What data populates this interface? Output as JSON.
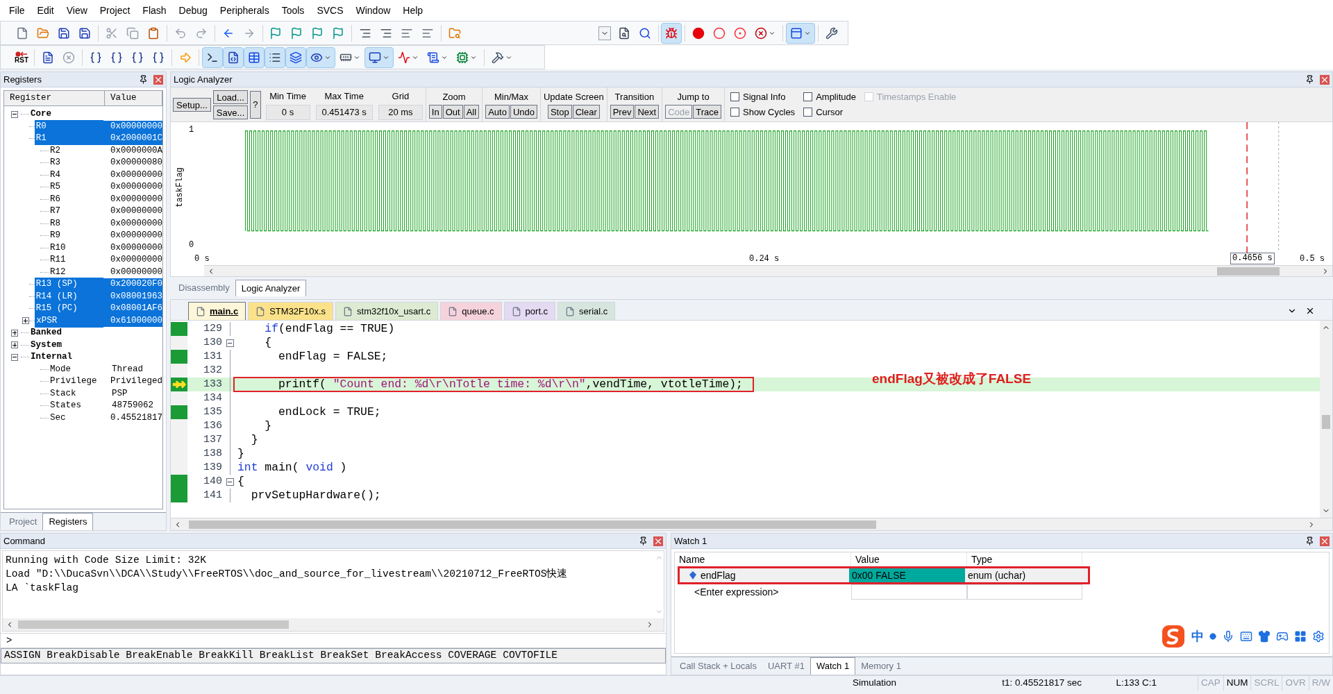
{
  "menu": [
    "File",
    "Edit",
    "View",
    "Project",
    "Flash",
    "Debug",
    "Peripherals",
    "Tools",
    "SVCS",
    "Window",
    "Help"
  ],
  "toolbar_file": [
    {
      "kind": "new",
      "on": false
    },
    {
      "kind": "open",
      "on": false
    },
    {
      "kind": "save",
      "on": false
    },
    {
      "kind": "save",
      "on": false
    },
    {
      "kind": "sep"
    },
    {
      "kind": "cut",
      "on": false
    },
    {
      "kind": "copy",
      "on": false
    },
    {
      "kind": "paste",
      "on": false
    },
    {
      "kind": "sep"
    },
    {
      "kind": "undo",
      "on": false
    },
    {
      "kind": "redo",
      "on": false
    },
    {
      "kind": "sep"
    },
    {
      "kind": "back",
      "on": false
    },
    {
      "kind": "forward",
      "on": false
    },
    {
      "kind": "sep"
    },
    {
      "kind": "flag",
      "on": false
    },
    {
      "kind": "flag",
      "on": false
    },
    {
      "kind": "flag",
      "on": false
    },
    {
      "kind": "flag",
      "on": false
    },
    {
      "kind": "sep"
    },
    {
      "kind": "indent",
      "on": false
    },
    {
      "kind": "indent",
      "on": false
    },
    {
      "kind": "lines",
      "on": false
    },
    {
      "kind": "lines",
      "on": false
    },
    {
      "kind": "sep"
    },
    {
      "kind": "folder-search",
      "on": false
    },
    {
      "kind": "gap"
    },
    {
      "kind": "combo",
      "on": false
    },
    {
      "kind": "file-search",
      "on": false
    },
    {
      "kind": "find",
      "on": false
    },
    {
      "kind": "sep"
    },
    {
      "kind": "debug",
      "on": true
    },
    {
      "kind": "sep"
    },
    {
      "kind": "bp",
      "on": false
    },
    {
      "kind": "bp-off",
      "on": false
    },
    {
      "kind": "bp-disable",
      "on": false
    },
    {
      "kind": "bp-kill",
      "on": false
    },
    {
      "kind": "sep"
    },
    {
      "kind": "layout",
      "on": true
    },
    {
      "kind": "sep"
    },
    {
      "kind": "wrench",
      "on": false
    }
  ],
  "toolbar_debug": {
    "reset_label": "RST",
    "items": [
      {
        "kind": "step-file",
        "on": false
      },
      {
        "kind": "stop",
        "on": false
      },
      {
        "kind": "sep"
      },
      {
        "kind": "braces",
        "on": false
      },
      {
        "kind": "braces",
        "on": false
      },
      {
        "kind": "braces",
        "on": false
      },
      {
        "kind": "braces",
        "on": false
      },
      {
        "kind": "sep"
      },
      {
        "kind": "run-cursor",
        "on": false
      },
      {
        "kind": "sep"
      },
      {
        "kind": "terminal",
        "on": true
      },
      {
        "kind": "disasm",
        "on": true
      },
      {
        "kind": "symbols",
        "on": true
      },
      {
        "kind": "registers",
        "on": true
      },
      {
        "kind": "callstack",
        "on": true
      },
      {
        "kind": "watch",
        "on": true
      },
      {
        "kind": "memory",
        "on": false
      },
      {
        "kind": "serial",
        "on": true
      },
      {
        "kind": "analysis",
        "on": false
      },
      {
        "kind": "trace",
        "on": false
      },
      {
        "kind": "chip",
        "on": false
      },
      {
        "kind": "sep"
      },
      {
        "kind": "toolbox",
        "on": false
      }
    ]
  },
  "registers": {
    "title": "Registers",
    "columns": [
      "Register",
      "Value"
    ],
    "tree": [
      {
        "name": "Core",
        "expanded": true,
        "children": [
          {
            "name": "R0",
            "value": "0x00000000",
            "selected": true
          },
          {
            "name": "R1",
            "value": "0x2000001C",
            "selected": true
          },
          {
            "name": "R2",
            "value": "0x0000000A",
            "selected": false
          },
          {
            "name": "R3",
            "value": "0x00000080",
            "selected": false
          },
          {
            "name": "R4",
            "value": "0x00000000",
            "selected": false
          },
          {
            "name": "R5",
            "value": "0x00000000",
            "selected": false
          },
          {
            "name": "R6",
            "value": "0x00000000",
            "selected": false
          },
          {
            "name": "R7",
            "value": "0x00000000",
            "selected": false
          },
          {
            "name": "R8",
            "value": "0x00000000",
            "selected": false
          },
          {
            "name": "R9",
            "value": "0x00000000",
            "selected": false
          },
          {
            "name": "R10",
            "value": "0x00000000",
            "selected": false
          },
          {
            "name": "R11",
            "value": "0x00000000",
            "selected": false
          },
          {
            "name": "R12",
            "value": "0x00000000",
            "selected": false
          },
          {
            "name": "R13 (SP)",
            "value": "0x200020F0",
            "selected": true
          },
          {
            "name": "R14 (LR)",
            "value": "0x08001963",
            "selected": true
          },
          {
            "name": "R15 (PC)",
            "value": "0x08001AF6",
            "selected": true
          },
          {
            "name": "xPSR",
            "value": "0x61000000",
            "selected": true,
            "expanded": false
          }
        ]
      },
      {
        "name": "Banked",
        "expanded": false
      },
      {
        "name": "System",
        "expanded": false
      },
      {
        "name": "Internal",
        "expanded": true,
        "children": [
          {
            "name": "Mode",
            "value": "Thread",
            "selected": false
          },
          {
            "name": "Privilege",
            "value": "Privileged",
            "selected": false
          },
          {
            "name": "Stack",
            "value": "PSP",
            "selected": false
          },
          {
            "name": "States",
            "value": "48759062",
            "selected": false
          },
          {
            "name": "Sec",
            "value": "0.45521817",
            "selected": false
          }
        ]
      }
    ],
    "tabs": [
      {
        "label": "Project",
        "selected": false
      },
      {
        "label": "Registers",
        "selected": true
      }
    ]
  },
  "logic_analyzer": {
    "title": "Logic Analyzer",
    "setup": "Setup...",
    "load": "Load...",
    "save": "Save...",
    "help": "?",
    "fields": [
      {
        "label": "Min Time",
        "value": "0 s"
      },
      {
        "label": "Max Time",
        "value": "0.451473 s"
      },
      {
        "label": "Grid",
        "value": "20 ms"
      }
    ],
    "groups": [
      {
        "label": "Zoom",
        "buttons": [
          {
            "label": "In",
            "disabled": false
          },
          {
            "label": "Out",
            "disabled": false
          },
          {
            "label": "All",
            "disabled": false
          }
        ]
      },
      {
        "label": "Min/Max",
        "buttons": [
          {
            "label": "Auto",
            "disabled": false
          },
          {
            "label": "Undo",
            "disabled": false
          }
        ]
      },
      {
        "label": "Update Screen",
        "buttons": [
          {
            "label": "Stop",
            "disabled": false
          },
          {
            "label": "Clear",
            "disabled": false
          }
        ]
      },
      {
        "label": "Transition",
        "buttons": [
          {
            "label": "Prev",
            "disabled": false
          },
          {
            "label": "Next",
            "disabled": false
          }
        ]
      },
      {
        "label": "Jump to",
        "buttons": [
          {
            "label": "Code",
            "disabled": true
          },
          {
            "label": "Trace",
            "disabled": false
          }
        ]
      }
    ],
    "options": [
      {
        "label": "Signal Info",
        "checked": false,
        "disabled": false
      },
      {
        "label": "Amplitude",
        "checked": false,
        "disabled": false
      },
      {
        "label": "Timestamps Enable",
        "checked": false,
        "disabled": true
      },
      {
        "label": "Show Cycles",
        "checked": false,
        "disabled": false
      },
      {
        "label": "Cursor",
        "checked": false,
        "disabled": false
      }
    ],
    "signal": "taskFlag",
    "y_high": "1",
    "y_low": "0",
    "x_labels": [
      "0 s",
      "0.24 s",
      "0.5 s"
    ],
    "cursor_time": "0.4656 s"
  },
  "view_tabs": [
    {
      "label": "Disassembly",
      "selected": false
    },
    {
      "label": "Logic Analyzer",
      "selected": true
    }
  ],
  "file_tabs": [
    {
      "label": "main.c",
      "selected": true,
      "color": "#fdf6d8"
    },
    {
      "label": "STM32F10x.s",
      "selected": false,
      "color": "#fbe28a"
    },
    {
      "label": "stm32f10x_usart.c",
      "selected": false,
      "color": "#dcebd2"
    },
    {
      "label": "queue.c",
      "selected": false,
      "color": "#f6d3dc"
    },
    {
      "label": "port.c",
      "selected": false,
      "color": "#e4daf2"
    },
    {
      "label": "serial.c",
      "selected": false,
      "color": "#d6e6de"
    }
  ],
  "code": [
    {
      "number": "129",
      "executable": true,
      "current": false,
      "fold": false,
      "segments": [
        {
          "kind": "keyword",
          "text": "    if"
        },
        {
          "kind": "plain",
          "text": "(endFlag == TRUE)"
        }
      ]
    },
    {
      "number": "130",
      "executable": false,
      "current": false,
      "fold": true,
      "segments": [
        {
          "kind": "plain",
          "text": "    {"
        }
      ]
    },
    {
      "number": "131",
      "executable": true,
      "current": false,
      "fold": false,
      "segments": [
        {
          "kind": "plain",
          "text": "      endFlag = FALSE;"
        }
      ]
    },
    {
      "number": "132",
      "executable": false,
      "current": false,
      "fold": false
    },
    {
      "number": "133",
      "executable": true,
      "current": true,
      "fold": false,
      "boxed": true,
      "segments": [
        {
          "kind": "plain",
          "text": "      printf( "
        },
        {
          "kind": "string",
          "text": "\"Count end: %d\\r\\nTotle time: %d\\r\\n\""
        },
        {
          "kind": "plain",
          "text": ",vendTime, vtotleTime);"
        }
      ]
    },
    {
      "number": "134",
      "executable": false,
      "current": false,
      "fold": false
    },
    {
      "number": "135",
      "executable": true,
      "current": false,
      "fold": false,
      "segments": [
        {
          "kind": "plain",
          "text": "      endLock = TRUE;"
        }
      ]
    },
    {
      "number": "136",
      "executable": false,
      "current": false,
      "fold": false,
      "segments": [
        {
          "kind": "plain",
          "text": "    }"
        }
      ]
    },
    {
      "number": "137",
      "executable": false,
      "current": false,
      "fold": false,
      "segments": [
        {
          "kind": "plain",
          "text": "  }"
        }
      ]
    },
    {
      "number": "138",
      "executable": false,
      "current": false,
      "fold": false,
      "segments": [
        {
          "kind": "plain",
          "text": "}"
        }
      ]
    },
    {
      "number": "139",
      "executable": false,
      "current": false,
      "fold": false,
      "segments": [
        {
          "kind": "keyword",
          "text": "int"
        },
        {
          "kind": "plain",
          "text": " main( "
        },
        {
          "kind": "keyword",
          "text": "void"
        },
        {
          "kind": "plain",
          "text": " )"
        }
      ]
    },
    {
      "number": "140",
      "executable": true,
      "current": false,
      "fold": true,
      "segments": [
        {
          "kind": "plain",
          "text": "{"
        }
      ]
    },
    {
      "number": "141",
      "executable": true,
      "current": false,
      "fold": false,
      "segments": [
        {
          "kind": "plain",
          "text": "  prvSetupHardware();"
        }
      ]
    }
  ],
  "annotation": "endFlag又被改成了FALSE",
  "command": {
    "title": "Command",
    "lines": [
      "Running with Code Size Limit: 32K",
      "Load \"D:\\\\DucaSvn\\\\DCA\\\\Study\\\\FreeRTOS\\\\doc_and_source_for_livestream\\\\20210712_FreeRTOS快速",
      "LA `taskFlag"
    ],
    "prompt": ">",
    "hints": "ASSIGN BreakDisable BreakEnable BreakKill BreakList BreakSet BreakAccess COVERAGE COVTOFILE"
  },
  "watch": {
    "title": "Watch 1",
    "columns": [
      "Name",
      "Value",
      "Type"
    ],
    "rows": [
      {
        "name": "endFlag",
        "value": "0x00 FALSE",
        "type": "enum (uchar)",
        "changed": true,
        "boxed": true
      }
    ],
    "placeholder": "<Enter expression>",
    "ime": "中",
    "tabs": [
      {
        "label": "Call Stack + Locals",
        "selected": false
      },
      {
        "label": "UART #1",
        "selected": false
      },
      {
        "label": "Watch 1",
        "selected": true
      },
      {
        "label": "Memory 1",
        "selected": false
      }
    ]
  },
  "status_bar": {
    "mode": "Simulation",
    "time": "t1: 0.45521817 sec",
    "position": "L:133 C:1",
    "indicators": [
      {
        "label": "CAP",
        "on": false
      },
      {
        "label": "NUM",
        "on": true
      },
      {
        "label": "SCRL",
        "on": false
      },
      {
        "label": "OVR",
        "on": false
      },
      {
        "label": "R/W",
        "on": false
      }
    ]
  }
}
